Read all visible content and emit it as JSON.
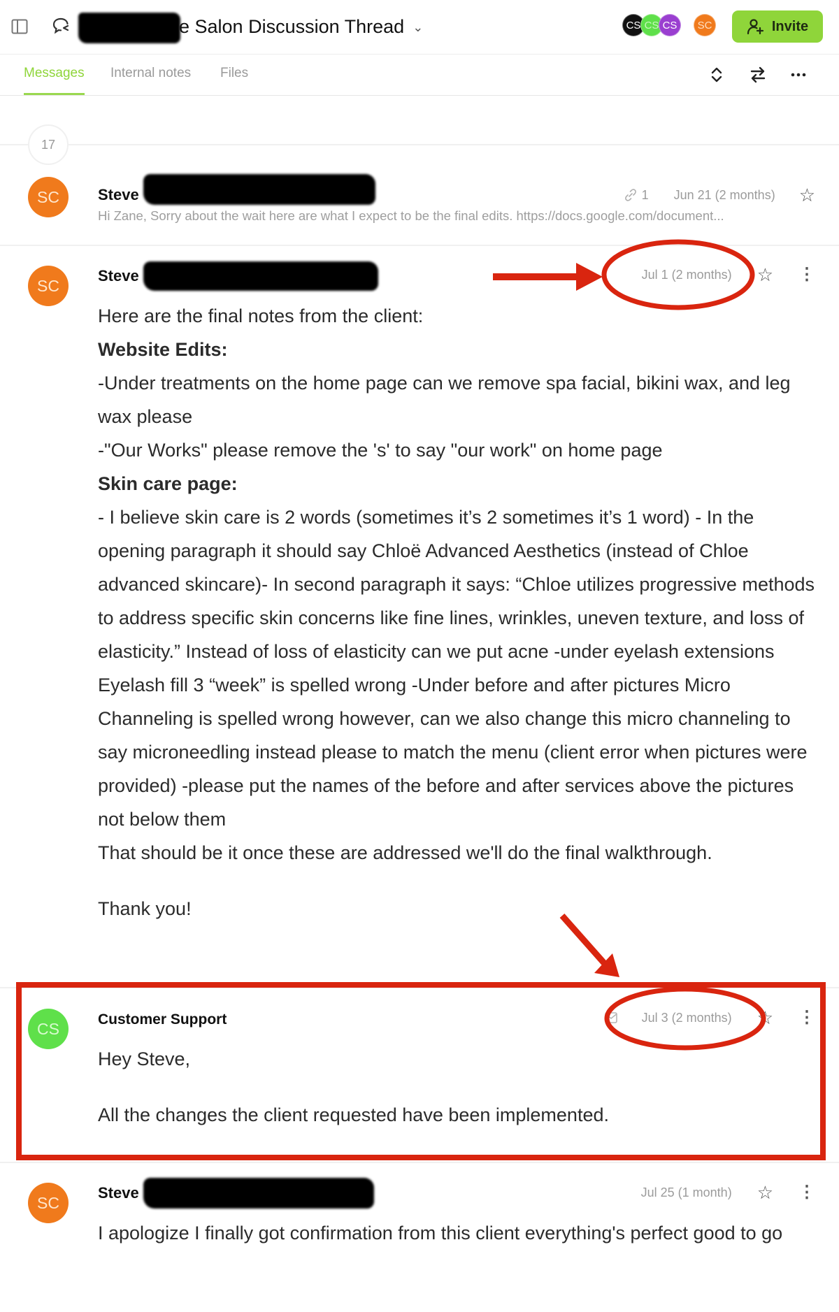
{
  "header": {
    "title": "e Salon Discussion Thread",
    "title_redacted": true,
    "title_chevron": "⌄",
    "participants": [
      {
        "initials": "CS",
        "color": "#111111"
      },
      {
        "initials": "CS",
        "color": "#5fe04a"
      },
      {
        "initials": "CS",
        "color": "#9a3fd0"
      }
    ],
    "owner": {
      "initials": "SC",
      "color": "#f07a1c"
    },
    "invite_label": "Invite",
    "accent_color": "#8fd53a"
  },
  "tabs": [
    {
      "label": "Messages",
      "active": true
    },
    {
      "label": "Internal notes",
      "active": false
    },
    {
      "label": "Files",
      "active": false
    }
  ],
  "toolbar": {
    "expand_icon": "expand-collapse-icon",
    "swap_icon": "swap-arrows-icon",
    "more_icon": "more-horizontal-icon"
  },
  "collapsed_count": "17",
  "messages": [
    {
      "sender": "Steve",
      "sender_suffix_redacted": true,
      "avatar_initials": "SC",
      "avatar_color": "#f07a1c",
      "attachment_count": "1",
      "date": "Jun 21 (2 months)",
      "preview": "Hi Zane, Sorry about the wait here are what I expect to be the final edits. https://docs.google.com/document...",
      "collapsed": true
    },
    {
      "sender": "Steve",
      "sender_suffix_redacted": true,
      "avatar_initials": "SC",
      "avatar_color": "#f07a1c",
      "date": "Jul 1 (2 months)",
      "highlighted": true,
      "body": [
        {
          "text": "Here are the final notes from the client:",
          "bold": false
        },
        {
          "text": "Website Edits:",
          "bold": true
        },
        {
          "text": "-Under treatments on the home page can we remove spa facial, bikini wax, and leg wax please",
          "bold": false
        },
        {
          "text": "-\"Our Works\" please remove the 's' to say \"our work\" on home page",
          "bold": false
        },
        {
          "text": "Skin care page:",
          "bold": true
        },
        {
          "text": "- I believe skin care is 2 words (sometimes it’s 2 sometimes it’s 1 word) - In the opening paragraph it should say Chloë Advanced Aesthetics (instead of Chloe advanced skincare)- In second paragraph it says: “Chloe utilizes progressive methods to address specific skin concerns like fine lines, wrinkles, uneven texture, and loss of elasticity.” Instead of loss of elasticity can we put acne -under eyelash extensions Eyelash fill 3 “week” is spelled wrong -Under before and after pictures Micro Channeling is spelled wrong however, can we also change this micro channeling to say microneedling instead please to match the menu (client error when pictures were provided) -please put the names of the before and after services above the pictures not below them",
          "bold": false
        },
        {
          "text": "That should be it once these are addressed we'll do the final walkthrough.",
          "bold": false
        },
        {
          "text": "",
          "bold": false
        },
        {
          "text": "Thank you!",
          "bold": false
        }
      ]
    },
    {
      "sender": "Customer Support",
      "avatar_initials": "CS",
      "avatar_color": "#5fe04a",
      "channel_icon": "email-icon",
      "date": "Jul 3 (2 months)",
      "highlighted": true,
      "body": [
        {
          "text": "Hey Steve,",
          "bold": false
        },
        {
          "text": "",
          "bold": false
        },
        {
          "text": "All the changes the client requested have been implemented.",
          "bold": false
        }
      ]
    },
    {
      "sender": "Steve",
      "sender_suffix_redacted": true,
      "avatar_initials": "SC",
      "avatar_color": "#f07a1c",
      "date": "Jul 25 (1 month)",
      "body": [
        {
          "text": "I apologize I finally got confirmation from this client everything's perfect good to go",
          "bold": false
        }
      ]
    }
  ],
  "annotations": {
    "color": "#d9250f"
  }
}
